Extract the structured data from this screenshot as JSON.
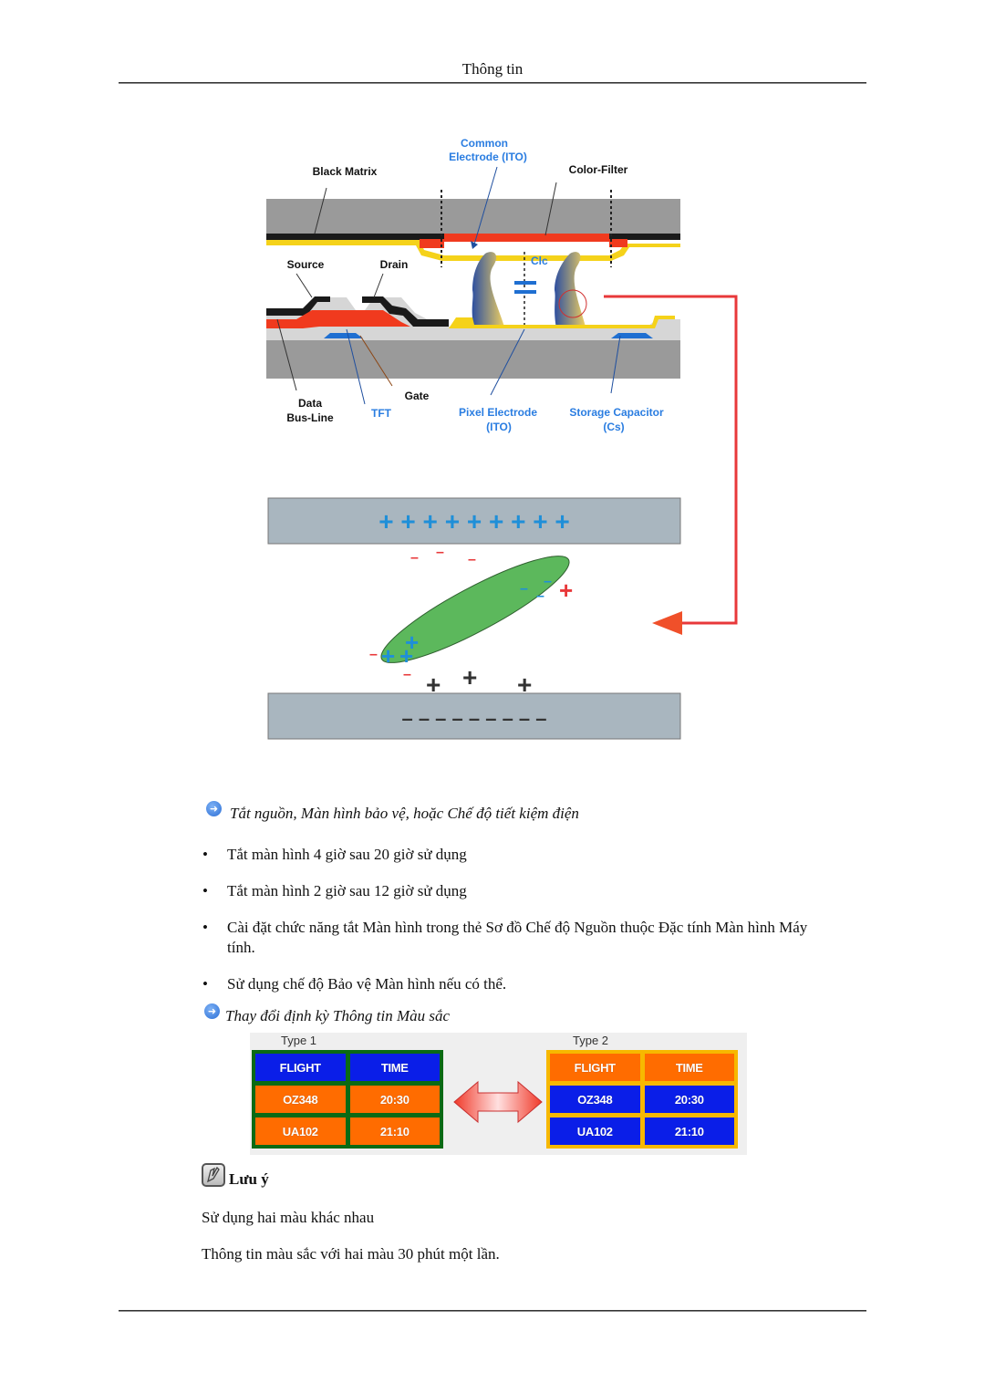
{
  "header": {
    "title": "Thông tin"
  },
  "diagram": {
    "labels": {
      "common_electrode_line1": "Common",
      "common_electrode_line2": "Electrode (ITO)",
      "black_matrix": "Black Matrix",
      "color_filter": "Color-Filter",
      "source": "Source",
      "drain": "Drain",
      "clc": "Clc",
      "data_bus_line1": "Data",
      "data_bus_line2": "Bus-Line",
      "tft": "TFT",
      "gate": "Gate",
      "pixel_electrode_line1": "Pixel Electrode",
      "pixel_electrode_line2": "(ITO)",
      "storage_capacitor_line1": "Storage Capacitor",
      "storage_capacitor_line2": "(Cs)"
    },
    "top_plate_charges": "+ + + + + + + + +",
    "bottom_plate_charges": "– – – – – – – – –",
    "colors": {
      "substrate": "#9a9a9a",
      "black_matrix": "#1a1a1a",
      "color_filter": "#f03a1e",
      "ito": "#f5d21a",
      "electrode_blue": "#1f6fd1",
      "label_blue": "#2a7de1",
      "plate": "#a9b6bf",
      "molecule": "#5cb85c",
      "signal_arrow": "#e8383a"
    }
  },
  "section1": {
    "heading": "Tắt nguồn, Màn hình bảo vệ, hoặc Chế độ tiết kiệm điện",
    "bullets": [
      "Tắt màn hình 4 giờ sau 20 giờ sử dụng",
      "Tắt màn hình 2 giờ sau 12 giờ sử dụng",
      "Cài đặt chức năng tắt Màn hình trong thẻ Sơ đồ Chế độ Nguồn thuộc Đặc tính Màn hình Máy tính.",
      "Sử dụng chế độ Bảo vệ Màn hình nếu có thể."
    ]
  },
  "section2": {
    "heading": "Thay đổi định kỳ Thông tin Màu sắc",
    "type1": {
      "label": "Type 1",
      "cells": [
        "FLIGHT",
        "TIME",
        "OZ348",
        "20:30",
        "UA102",
        "21:10"
      ],
      "header_color": "#0a1ee8",
      "body_color": "#ff6c00",
      "border_color": "#0a6a14"
    },
    "type2": {
      "label": "Type 2",
      "cells": [
        "FLIGHT",
        "TIME",
        "OZ348",
        "20:30",
        "UA102",
        "21:10"
      ],
      "header_color": "#ff6c00",
      "body_color": "#0a1ee8",
      "border_color": "#f7b800"
    }
  },
  "note": {
    "label": "Lưu ý",
    "lines": [
      "Sử dụng hai màu khác nhau",
      "Thông tin màu sắc với hai màu 30 phút một lần."
    ]
  }
}
